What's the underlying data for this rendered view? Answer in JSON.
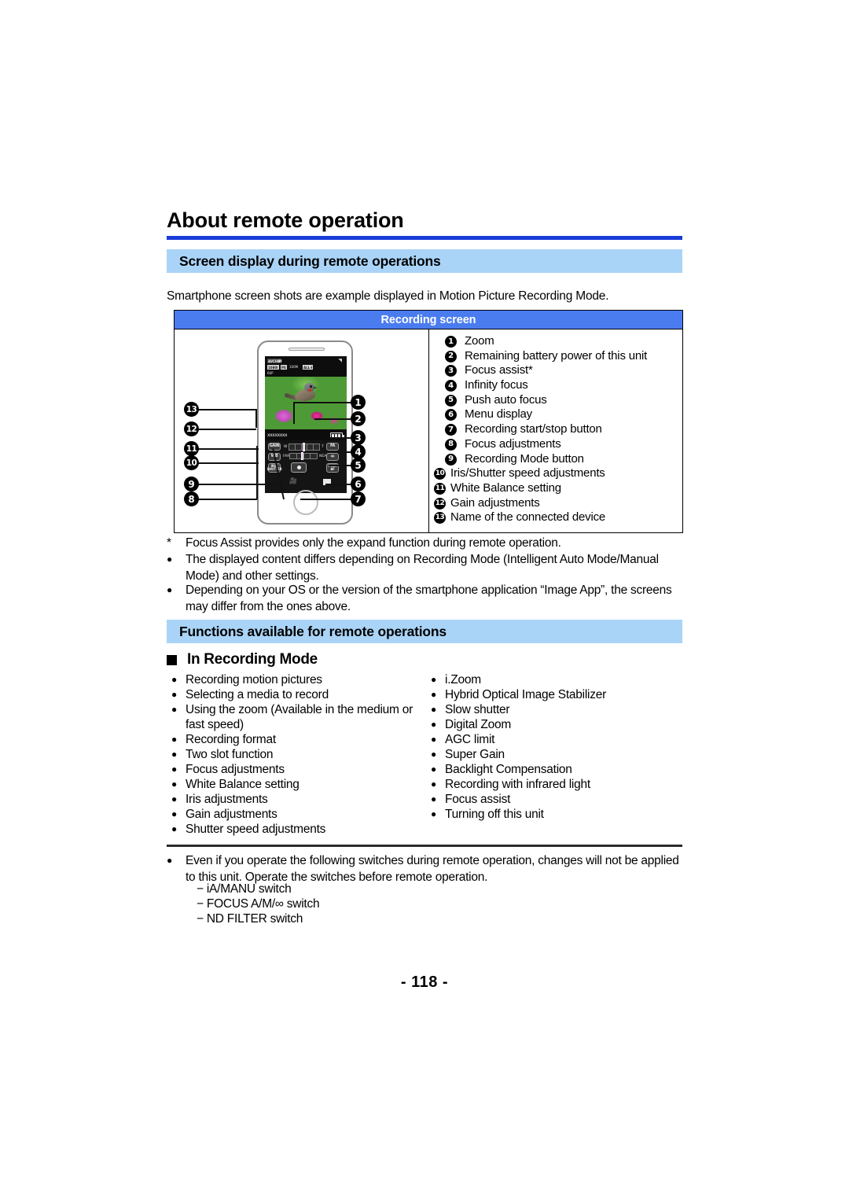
{
  "document": {
    "title": "About remote operation",
    "page_number": "- 118 -"
  },
  "sections": {
    "screen_display": {
      "heading": "Screen display during remote operations",
      "intro": "Smartphone screen shots are example displayed in Motion Picture Recording Mode."
    },
    "functions": {
      "heading": "Functions available for remote operations",
      "subheading": "In Recording Mode"
    }
  },
  "recording_table": {
    "header": "Recording screen",
    "legend": [
      {
        "num": "1",
        "label": "Zoom"
      },
      {
        "num": "2",
        "label": "Remaining battery power of this unit"
      },
      {
        "num": "3",
        "label": "Focus assist*"
      },
      {
        "num": "4",
        "label": "Infinity focus"
      },
      {
        "num": "5",
        "label": "Push auto focus"
      },
      {
        "num": "6",
        "label": "Menu display"
      },
      {
        "num": "7",
        "label": "Recording start/stop button"
      },
      {
        "num": "8",
        "label": "Focus adjustments"
      },
      {
        "num": "9",
        "label": "Recording Mode button"
      },
      {
        "num": "10",
        "label": "Iris/Shutter speed adjustments"
      },
      {
        "num": "11",
        "label": "White Balance setting"
      },
      {
        "num": "12",
        "label": "Gain adjustments"
      },
      {
        "num": "13",
        "label": "Name of the connected device"
      }
    ]
  },
  "phone_mockup": {
    "device_name": "xxxxxxxx",
    "status_chips": [
      "AVCHD",
      "1080i",
      "PS",
      "100M",
      "ALL-I",
      "60P"
    ],
    "buttons": {
      "gain": "GAIN",
      "wb": "WB",
      "iris_shutter": "IRIS/\nSHUTTER",
      "focus_assist": "FA",
      "infinity": "∞",
      "push_af": "PUSH\nAF"
    },
    "zoom_labels": {
      "wide": "W",
      "tele": "T",
      "far": "FAR",
      "near": "NEAR"
    },
    "callouts_left": [
      "13",
      "12",
      "11",
      "10",
      "9",
      "8"
    ],
    "callouts_right": [
      "1",
      "2",
      "3",
      "4",
      "5",
      "6",
      "7"
    ]
  },
  "notes_after_table": [
    {
      "marker": "*",
      "text": "Focus Assist provides only the expand function during remote operation."
    },
    {
      "marker": "●",
      "text": "The displayed content differs depending on Recording Mode (Intelligent Auto Mode/Manual Mode) and other settings."
    },
    {
      "marker": "●",
      "text": "Depending on your OS or the version of the smartphone application “Image App”, the screens may differ from the ones above."
    }
  ],
  "recording_mode_functions": {
    "left_column": [
      "Recording motion pictures",
      "Selecting a media to record",
      "Using the zoom (Available in the medium or fast speed)",
      "Recording format",
      "Two slot function",
      "Focus adjustments",
      "White Balance setting",
      "Iris adjustments",
      "Gain adjustments",
      "Shutter speed adjustments"
    ],
    "right_column": [
      "i.Zoom",
      "Hybrid Optical Image Stabilizer",
      "Slow shutter",
      "Digital Zoom",
      "AGC limit",
      "Super Gain",
      "Backlight Compensation",
      "Recording with infrared light",
      "Focus assist",
      "Turning off this unit"
    ]
  },
  "bottom_note": {
    "text": "Even if you operate the following switches during remote operation, changes will not be applied to this unit. Operate the switches before remote operation.",
    "switches": [
      "iA/MANU switch",
      "FOCUS A/M/∞ switch",
      "ND FILTER switch"
    ]
  },
  "colors": {
    "title_rule": "#1a3cd8",
    "section_bar": "#aad4f7",
    "table_header": "#4a7cf0"
  }
}
